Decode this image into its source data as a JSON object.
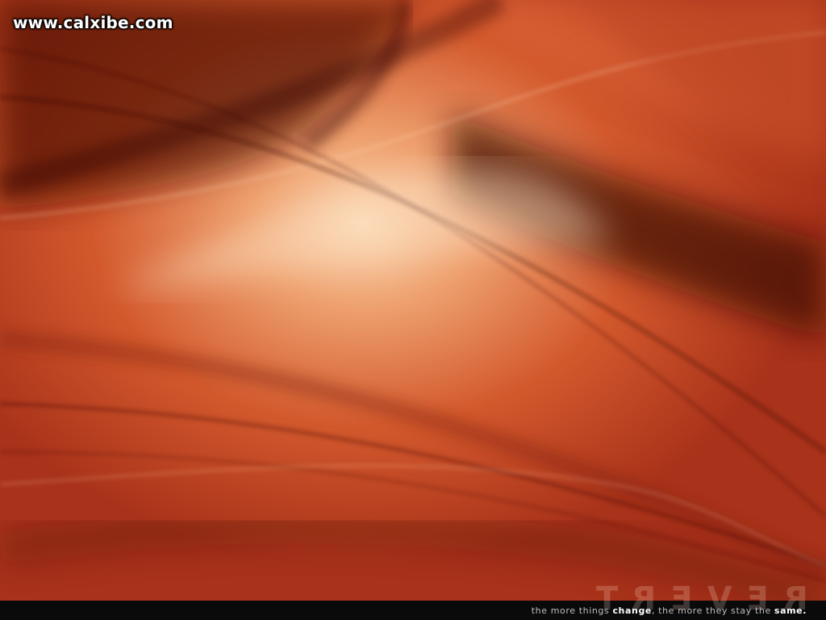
{
  "watermark": {
    "text": "www.calxibe.com"
  },
  "artwork": {
    "style": "abstract orange swooshes",
    "colors": {
      "deep": "#5a1206",
      "mid": "#c9481f",
      "light": "#f7c9a0"
    }
  },
  "mirrored_title": "REVERT",
  "tagline": {
    "part1": "the more things ",
    "emph1": "change",
    "part2": ", the more they stay the ",
    "emph2": "same."
  }
}
